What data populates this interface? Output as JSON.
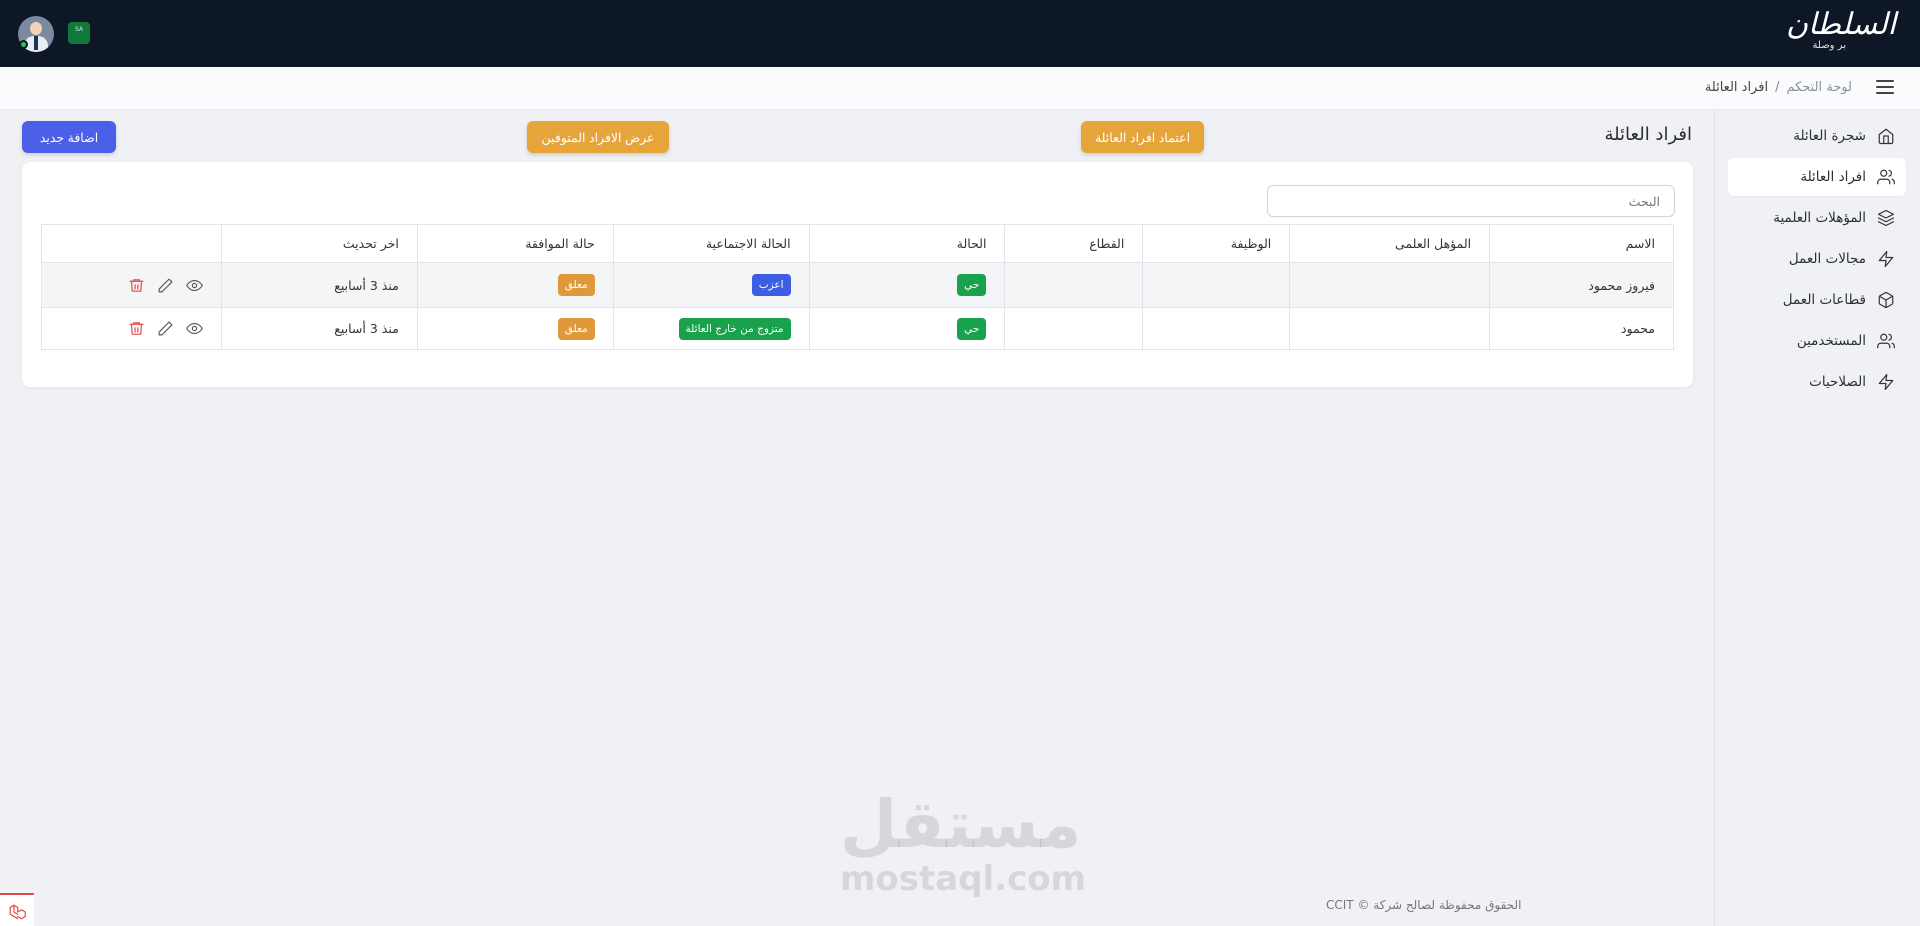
{
  "header": {
    "logo_text": "السلطان",
    "logo_sub": "بر وصلة",
    "flag_text": "SA"
  },
  "breadcrumb": {
    "home": "لوحة التحكم",
    "separator": "/",
    "current": "افراد العائلة"
  },
  "sidebar": {
    "items": [
      {
        "label": "شجرة العائلة",
        "icon": "home-icon"
      },
      {
        "label": "افراد العائلة",
        "icon": "users-icon",
        "active": true
      },
      {
        "label": "المؤهلات العلمية",
        "icon": "layers-icon"
      },
      {
        "label": "مجالات العمل",
        "icon": "zap-icon"
      },
      {
        "label": "قطاعات العمل",
        "icon": "box-icon"
      },
      {
        "label": "المستخدمين",
        "icon": "users-icon"
      },
      {
        "label": "الصلاحيات",
        "icon": "zap-icon"
      }
    ]
  },
  "main": {
    "title": "افراد العائلة",
    "approve_button": "اعتماد افراد العائلة",
    "deceased_button": "عرض الافراد المتوفين",
    "add_button": "اضافة جديد",
    "search_placeholder": "البحث"
  },
  "table": {
    "columns": [
      "الاسم",
      "المؤهل العلمى",
      "الوظيفة",
      "القطاع",
      "الحالة",
      "الحالة الاجتماعية",
      "حالة الموافقة",
      "اخر تحديث",
      ""
    ],
    "rows": [
      {
        "name": "فيروز محمود",
        "qualification": "",
        "job": "",
        "sector": "",
        "status": "حي",
        "social": "اعزب",
        "approval": "معلق",
        "updated": "منذ 3 أسابيع"
      },
      {
        "name": "محمود",
        "qualification": "",
        "job": "",
        "sector": "",
        "status": "حي",
        "social": "متزوج من خارج العائلة",
        "approval": "معلق",
        "updated": "منذ 3 أسابيع"
      }
    ]
  },
  "footer": {
    "text": "الحقوق محفوظة لصالح شركة © CCIT"
  },
  "watermark": {
    "ar": "مستقل",
    "en": "mostaql.com"
  },
  "colors": {
    "topbar": "#0d1726",
    "accent_blue": "#4b5fe8",
    "accent_orange": "#e6a53b",
    "status_green": "#17a24b",
    "danger": "#e04b4b"
  }
}
